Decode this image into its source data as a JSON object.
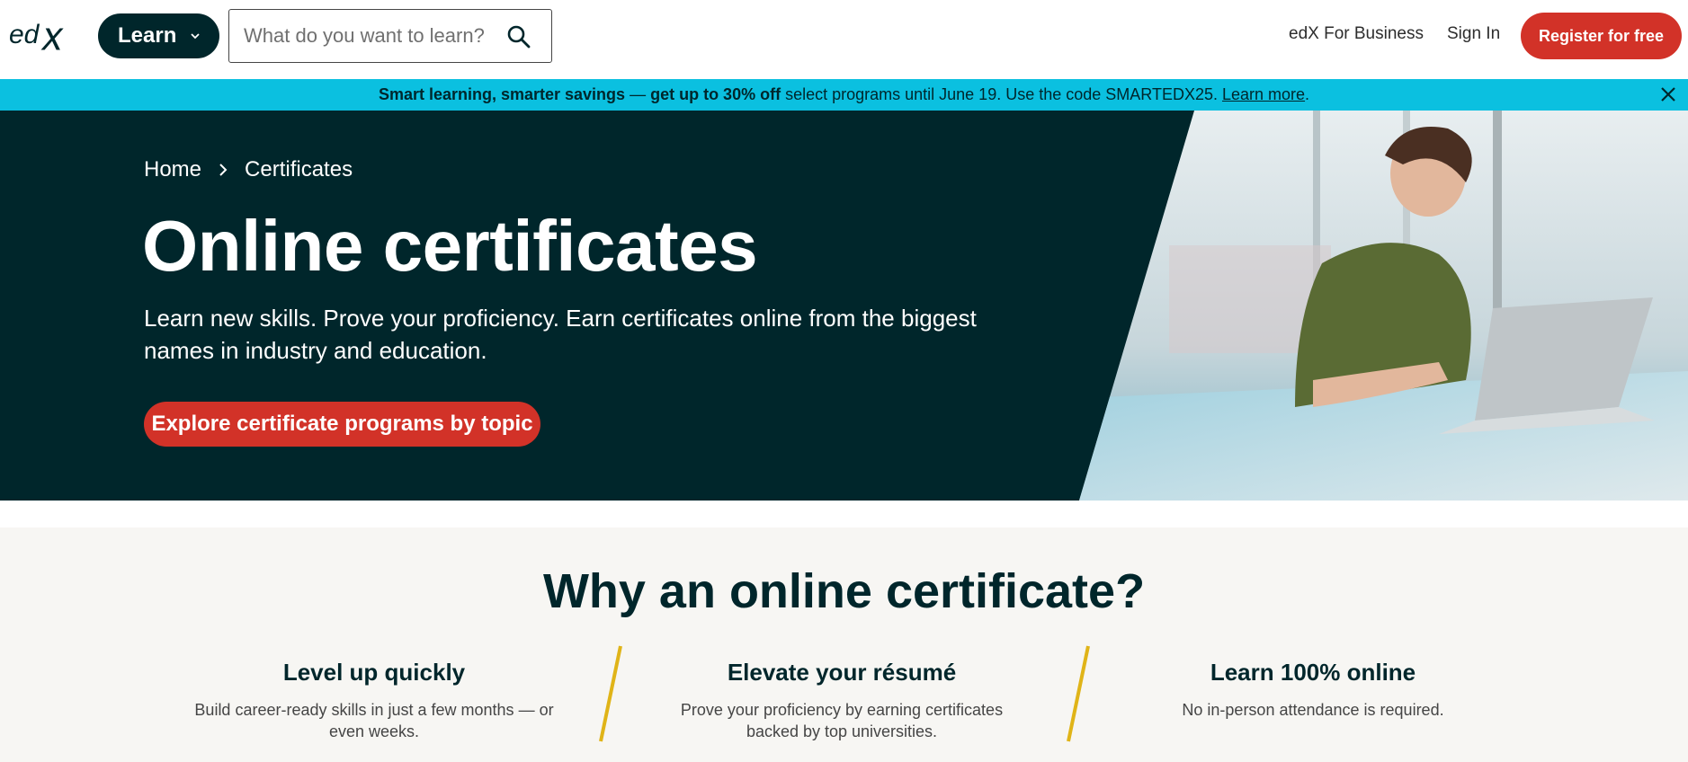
{
  "header": {
    "logo_text": "edX",
    "learn_label": "Learn",
    "search_placeholder": "What do you want to learn?",
    "business_link": "edX For Business",
    "signin_link": "Sign In",
    "register_label": "Register for free"
  },
  "promo": {
    "bold_text": "Smart learning, smarter savings",
    "dash": " — ",
    "bold_offer": "get up to 30% off",
    "rest_text": " select programs until June 19. Use the code SMARTEDX25. ",
    "link_text": "Learn more",
    "end": "."
  },
  "hero": {
    "breadcrumb_home": "Home",
    "breadcrumb_current": "Certificates",
    "title": "Online certificates",
    "subtitle": "Learn new skills. Prove your proficiency. Earn certificates online from the biggest names in industry and education.",
    "cta_label": "Explore certificate programs by topic"
  },
  "why": {
    "title": "Why an online certificate?",
    "features": [
      {
        "title": "Level up quickly",
        "text": "Build career-ready skills in just a few months — or even weeks."
      },
      {
        "title": "Elevate your résumé",
        "text": "Prove your proficiency by earning certificates backed by top universities."
      },
      {
        "title": "Learn 100% online",
        "text": "No in-person attendance is required."
      }
    ]
  },
  "colors": {
    "brand_dark": "#00262b",
    "accent_red": "#d23228",
    "promo_cyan": "#0bc0e0",
    "divider_gold": "#e0b418"
  },
  "icons": {
    "learn_chevron": "chevron-down-icon",
    "search": "search-icon",
    "close": "close-icon",
    "breadcrumb_separator": "chevron-right-icon"
  }
}
